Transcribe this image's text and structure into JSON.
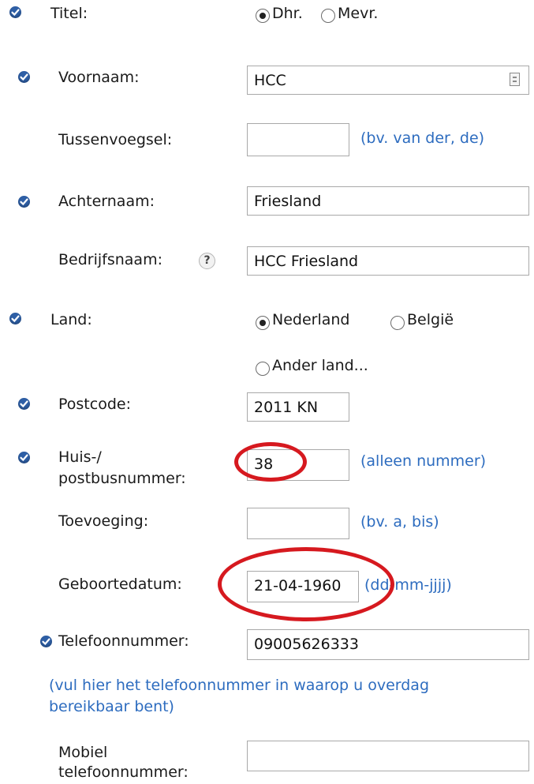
{
  "colors": {
    "check": "#2e5fa6",
    "hint": "#2d6cbf",
    "annotation": "#d6191f"
  },
  "titel": {
    "label": "Titel:",
    "options": [
      "Dhr.",
      "Mevr."
    ],
    "selected": "Dhr."
  },
  "voornaam": {
    "label": "Voornaam:",
    "value": "HCC"
  },
  "tussenvoegsel": {
    "label": "Tussenvoegsel:",
    "value": "",
    "hint": "(bv. van der, de)"
  },
  "achternaam": {
    "label": "Achternaam:",
    "value": "Friesland"
  },
  "bedrijfsnaam": {
    "label": "Bedrijfsnaam:",
    "help": "?",
    "value": "HCC Friesland"
  },
  "land": {
    "label": "Land:",
    "options": [
      "Nederland",
      "België",
      "Ander land..."
    ],
    "selected": "Nederland"
  },
  "postcode": {
    "label": "Postcode:",
    "value": "2011 KN"
  },
  "huisnummer": {
    "label_line1": "Huis-/",
    "label_line2": "postbusnummer:",
    "value": "38",
    "hint": "(alleen nummer)"
  },
  "toevoeging": {
    "label": "Toevoeging:",
    "value": "",
    "hint": "(bv. a, bis)"
  },
  "geboortedatum": {
    "label": "Geboortedatum:",
    "value": "21-04-1960",
    "hint": "(dd-mm-jjjj)"
  },
  "telefoonnummer": {
    "label": "Telefoonnummer:",
    "value": "09005626333",
    "note_line1": "(vul hier het telefoonnummer in waarop u overdag",
    "note_line2": "bereikbaar bent)"
  },
  "mobiel": {
    "label_line1": "Mobiel",
    "label_line2": "telefoonnummer:",
    "value": ""
  },
  "icons": {
    "required": "check-circle-icon",
    "contact_card": "contact-card-icon",
    "help": "help-icon"
  }
}
